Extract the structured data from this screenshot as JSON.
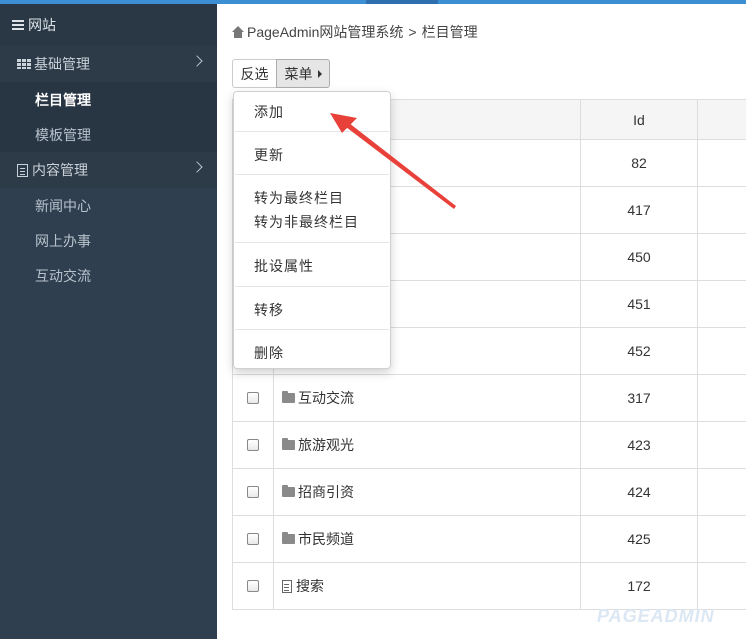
{
  "sidebar": {
    "header": "网站",
    "groups": [
      {
        "label": "基础管理",
        "items": [
          "栏目管理",
          "模板管理"
        ]
      },
      {
        "label": "内容管理",
        "items": [
          "新闻中心",
          "网上办事",
          "互动交流"
        ]
      }
    ]
  },
  "breadcrumb": {
    "site": "PageAdmin网站管理系统",
    "sep": ">",
    "current": "栏目管理"
  },
  "toolbar": {
    "invert_label": "反选",
    "menu_label": "菜单"
  },
  "table": {
    "headers": [
      "",
      "",
      "Id",
      ""
    ],
    "rows": [
      {
        "name": "",
        "id": "82"
      },
      {
        "name": "",
        "id": "417"
      },
      {
        "name": "",
        "id": "450"
      },
      {
        "name": "",
        "id": "451"
      },
      {
        "name": "",
        "id": "452"
      },
      {
        "name": "互动交流",
        "id": "317"
      },
      {
        "name": "旅游观光",
        "id": "423"
      },
      {
        "name": "招商引资",
        "id": "424"
      },
      {
        "name": "市民频道",
        "id": "425"
      },
      {
        "name": "搜索",
        "id": "172"
      }
    ]
  },
  "dropdown": {
    "items": [
      "添加",
      "更新",
      "转为最终栏目",
      "转为非最终栏目",
      "批设属性",
      "转移",
      "删除"
    ]
  },
  "annotation_color": "#e8413a",
  "watermark": "PAGEADMIN"
}
